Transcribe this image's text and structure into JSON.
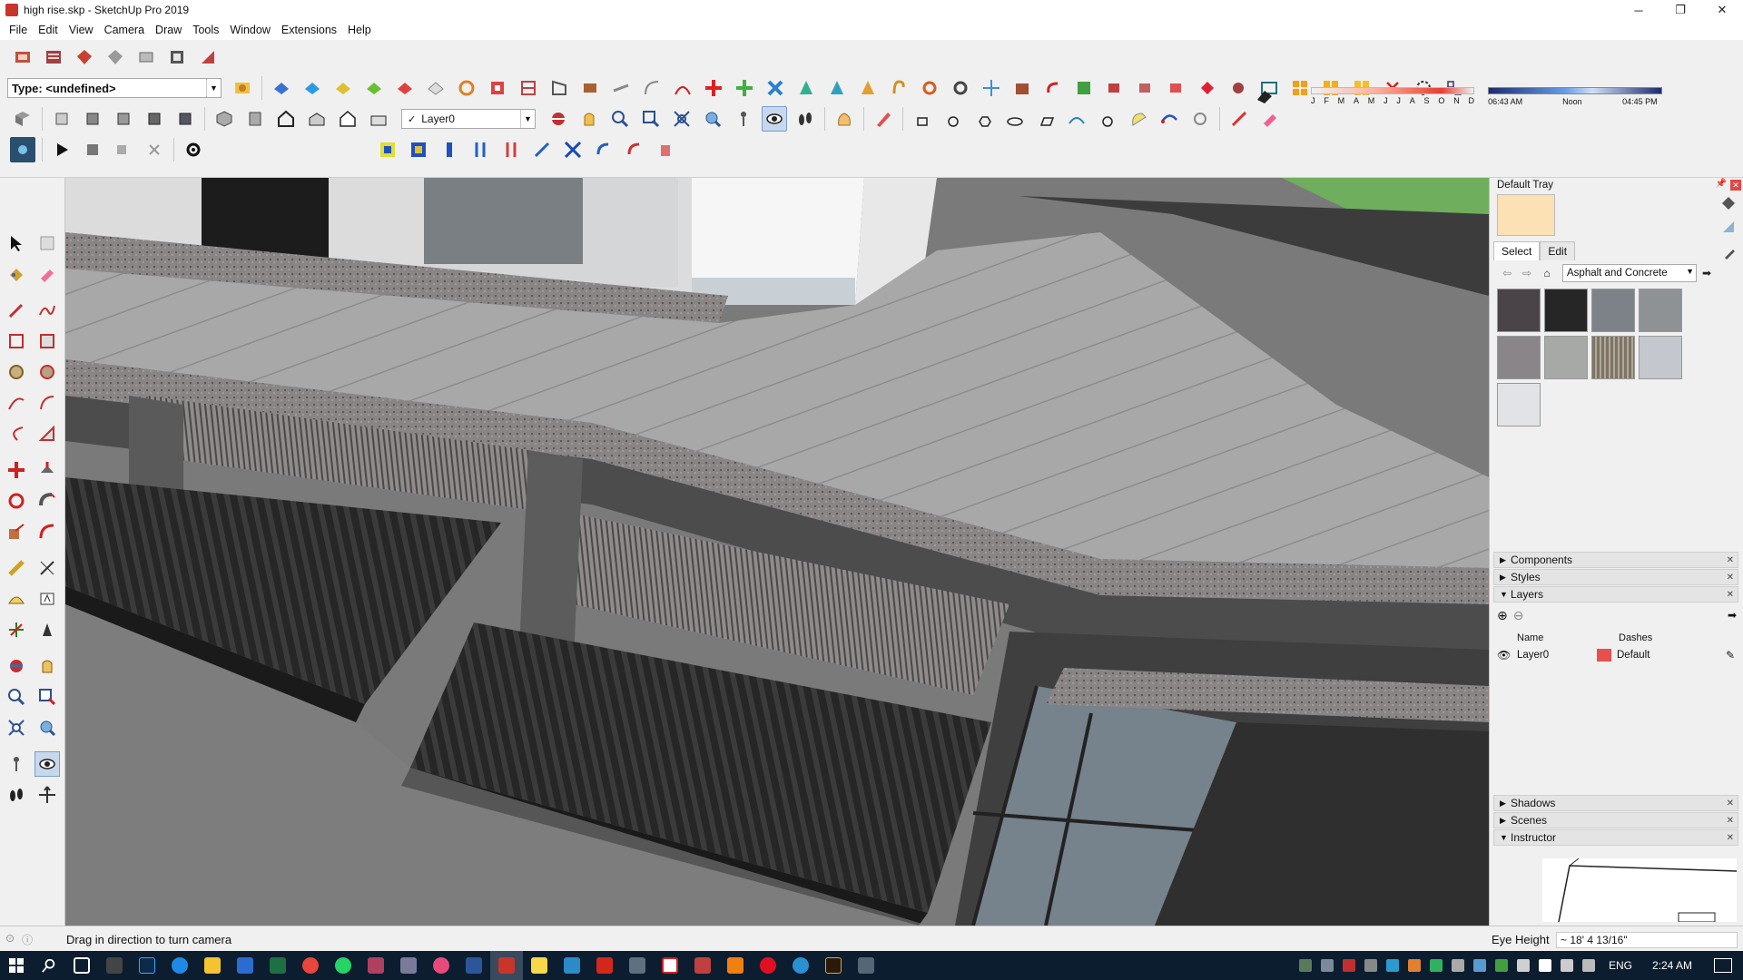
{
  "window": {
    "title": "high rise.skp - SketchUp Pro 2019",
    "minimize": "─",
    "restore": "❐",
    "close": "✕"
  },
  "menu": [
    "File",
    "Edit",
    "View",
    "Camera",
    "Draw",
    "Tools",
    "Window",
    "Extensions",
    "Help"
  ],
  "toolbar": {
    "type_select": "Type: <undefined>",
    "layer_select": "Layer0"
  },
  "shadow": {
    "months": [
      "J",
      "F",
      "M",
      "A",
      "M",
      "J",
      "J",
      "A",
      "S",
      "O",
      "N",
      "D"
    ],
    "time_start": "06:43 AM",
    "time_mid": "Noon",
    "time_end": "04:45 PM"
  },
  "tray": {
    "title": "Default Tray",
    "materials": {
      "tab_select": "Select",
      "tab_edit": "Edit",
      "library": "Asphalt and Concrete",
      "swatches": [
        "#4a4448",
        "#262627",
        "#7d8288",
        "#8f9294",
        "#8a8588",
        "#a6a9a6",
        "#7e7466",
        "#c4c7cd",
        "#e2e3e6"
      ]
    },
    "panels": {
      "components": "Components",
      "styles": "Styles",
      "layers": "Layers",
      "shadows": "Shadows",
      "scenes": "Scenes",
      "instructor": "Instructor"
    },
    "layers_table": {
      "col_name": "Name",
      "col_dashes": "Dashes",
      "rows": [
        {
          "name": "Layer0",
          "color": "#e85050",
          "dashes": "Default"
        }
      ]
    }
  },
  "status": {
    "hint": "Drag in direction to turn camera",
    "measure_label": "Eye Height",
    "measure_value": "~ 18' 4 13/16\""
  },
  "clock": {
    "lang": "ENG",
    "time": "2:24 AM"
  },
  "colors": {
    "accent": "#c8352a",
    "taskbar": "#0c1d2f",
    "swatch_current": "#fbe1b4"
  }
}
